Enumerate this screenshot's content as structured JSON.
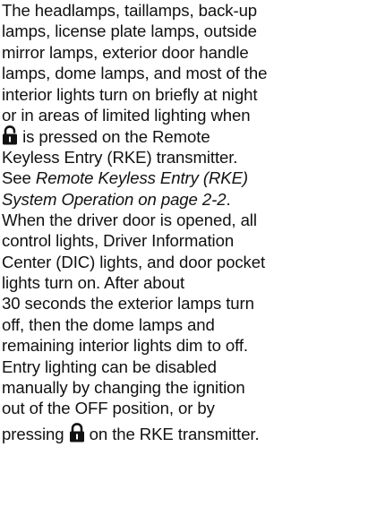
{
  "document": {
    "lines": [
      "The headlamps, taillamps, back-up",
      "lamps, license plate lamps, outside",
      "mirror lamps, exterior door handle",
      "lamps, dome lamps, and most of the",
      "interior lights turn on briefly at night",
      "or in areas of limited lighting when",
      "is pressed on the Remote",
      "Keyless Entry (RKE) transmitter.",
      "See",
      "Remote Keyless Entry (RKE)",
      "System Operation on page 2-2",
      ".",
      "When the driver door is opened, all",
      "control lights, Driver Information",
      "Center (DIC) lights, and door pocket",
      "lights turn on. After about",
      "30 seconds the exterior lamps turn",
      "off, then the dome lamps and",
      "remaining interior lights dim to off.",
      "Entry lighting can be disabled",
      "manually by changing the ignition",
      "out of the OFF position, or by",
      "pressing",
      "on the RKE transmitter."
    ],
    "icons": {
      "unlock": "unlock-icon",
      "lock": "lock-icon"
    }
  }
}
